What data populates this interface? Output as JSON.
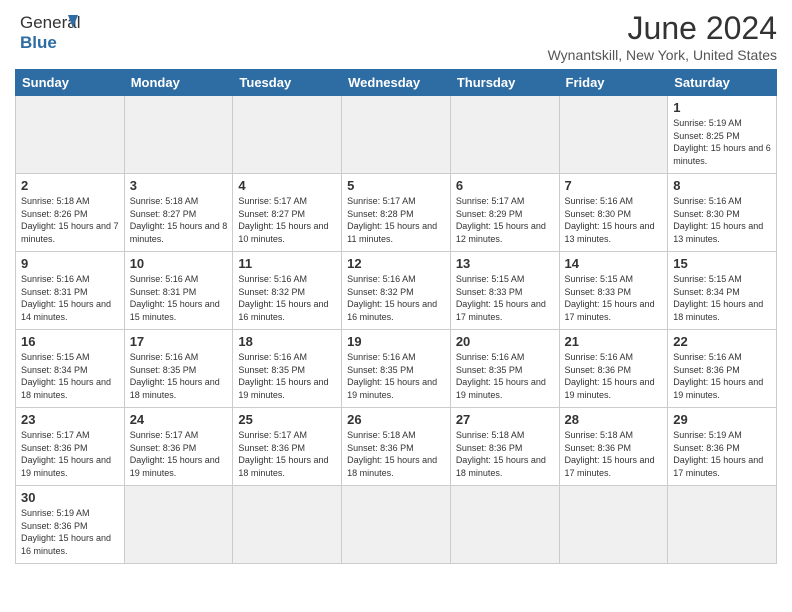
{
  "header": {
    "logo_line1": "General",
    "logo_line2": "Blue",
    "title": "June 2024",
    "subtitle": "Wynantskill, New York, United States"
  },
  "days_of_week": [
    "Sunday",
    "Monday",
    "Tuesday",
    "Wednesday",
    "Thursday",
    "Friday",
    "Saturday"
  ],
  "weeks": [
    [
      {
        "day": "",
        "empty": true
      },
      {
        "day": "",
        "empty": true
      },
      {
        "day": "",
        "empty": true
      },
      {
        "day": "",
        "empty": true
      },
      {
        "day": "",
        "empty": true
      },
      {
        "day": "",
        "empty": true
      },
      {
        "day": "1",
        "info": "Sunrise: 5:19 AM\nSunset: 8:25 PM\nDaylight: 15 hours\nand 6 minutes."
      }
    ],
    [
      {
        "day": "2",
        "info": "Sunrise: 5:18 AM\nSunset: 8:26 PM\nDaylight: 15 hours\nand 7 minutes."
      },
      {
        "day": "3",
        "info": "Sunrise: 5:18 AM\nSunset: 8:27 PM\nDaylight: 15 hours\nand 8 minutes."
      },
      {
        "day": "4",
        "info": "Sunrise: 5:17 AM\nSunset: 8:27 PM\nDaylight: 15 hours\nand 10 minutes."
      },
      {
        "day": "5",
        "info": "Sunrise: 5:17 AM\nSunset: 8:28 PM\nDaylight: 15 hours\nand 11 minutes."
      },
      {
        "day": "6",
        "info": "Sunrise: 5:17 AM\nSunset: 8:29 PM\nDaylight: 15 hours\nand 12 minutes."
      },
      {
        "day": "7",
        "info": "Sunrise: 5:16 AM\nSunset: 8:30 PM\nDaylight: 15 hours\nand 13 minutes."
      },
      {
        "day": "8",
        "info": "Sunrise: 5:16 AM\nSunset: 8:30 PM\nDaylight: 15 hours\nand 13 minutes."
      }
    ],
    [
      {
        "day": "9",
        "info": "Sunrise: 5:16 AM\nSunset: 8:31 PM\nDaylight: 15 hours\nand 14 minutes."
      },
      {
        "day": "10",
        "info": "Sunrise: 5:16 AM\nSunset: 8:31 PM\nDaylight: 15 hours\nand 15 minutes."
      },
      {
        "day": "11",
        "info": "Sunrise: 5:16 AM\nSunset: 8:32 PM\nDaylight: 15 hours\nand 16 minutes."
      },
      {
        "day": "12",
        "info": "Sunrise: 5:16 AM\nSunset: 8:32 PM\nDaylight: 15 hours\nand 16 minutes."
      },
      {
        "day": "13",
        "info": "Sunrise: 5:15 AM\nSunset: 8:33 PM\nDaylight: 15 hours\nand 17 minutes."
      },
      {
        "day": "14",
        "info": "Sunrise: 5:15 AM\nSunset: 8:33 PM\nDaylight: 15 hours\nand 17 minutes."
      },
      {
        "day": "15",
        "info": "Sunrise: 5:15 AM\nSunset: 8:34 PM\nDaylight: 15 hours\nand 18 minutes."
      }
    ],
    [
      {
        "day": "16",
        "info": "Sunrise: 5:15 AM\nSunset: 8:34 PM\nDaylight: 15 hours\nand 18 minutes."
      },
      {
        "day": "17",
        "info": "Sunrise: 5:16 AM\nSunset: 8:35 PM\nDaylight: 15 hours\nand 18 minutes."
      },
      {
        "day": "18",
        "info": "Sunrise: 5:16 AM\nSunset: 8:35 PM\nDaylight: 15 hours\nand 19 minutes."
      },
      {
        "day": "19",
        "info": "Sunrise: 5:16 AM\nSunset: 8:35 PM\nDaylight: 15 hours\nand 19 minutes."
      },
      {
        "day": "20",
        "info": "Sunrise: 5:16 AM\nSunset: 8:35 PM\nDaylight: 15 hours\nand 19 minutes."
      },
      {
        "day": "21",
        "info": "Sunrise: 5:16 AM\nSunset: 8:36 PM\nDaylight: 15 hours\nand 19 minutes."
      },
      {
        "day": "22",
        "info": "Sunrise: 5:16 AM\nSunset: 8:36 PM\nDaylight: 15 hours\nand 19 minutes."
      }
    ],
    [
      {
        "day": "23",
        "info": "Sunrise: 5:17 AM\nSunset: 8:36 PM\nDaylight: 15 hours\nand 19 minutes."
      },
      {
        "day": "24",
        "info": "Sunrise: 5:17 AM\nSunset: 8:36 PM\nDaylight: 15 hours\nand 19 minutes."
      },
      {
        "day": "25",
        "info": "Sunrise: 5:17 AM\nSunset: 8:36 PM\nDaylight: 15 hours\nand 18 minutes."
      },
      {
        "day": "26",
        "info": "Sunrise: 5:18 AM\nSunset: 8:36 PM\nDaylight: 15 hours\nand 18 minutes."
      },
      {
        "day": "27",
        "info": "Sunrise: 5:18 AM\nSunset: 8:36 PM\nDaylight: 15 hours\nand 18 minutes."
      },
      {
        "day": "28",
        "info": "Sunrise: 5:18 AM\nSunset: 8:36 PM\nDaylight: 15 hours\nand 17 minutes."
      },
      {
        "day": "29",
        "info": "Sunrise: 5:19 AM\nSunset: 8:36 PM\nDaylight: 15 hours\nand 17 minutes."
      }
    ],
    [
      {
        "day": "30",
        "info": "Sunrise: 5:19 AM\nSunset: 8:36 PM\nDaylight: 15 hours\nand 16 minutes."
      },
      {
        "day": "",
        "empty": true
      },
      {
        "day": "",
        "empty": true
      },
      {
        "day": "",
        "empty": true
      },
      {
        "day": "",
        "empty": true
      },
      {
        "day": "",
        "empty": true
      },
      {
        "day": "",
        "empty": true
      }
    ]
  ]
}
